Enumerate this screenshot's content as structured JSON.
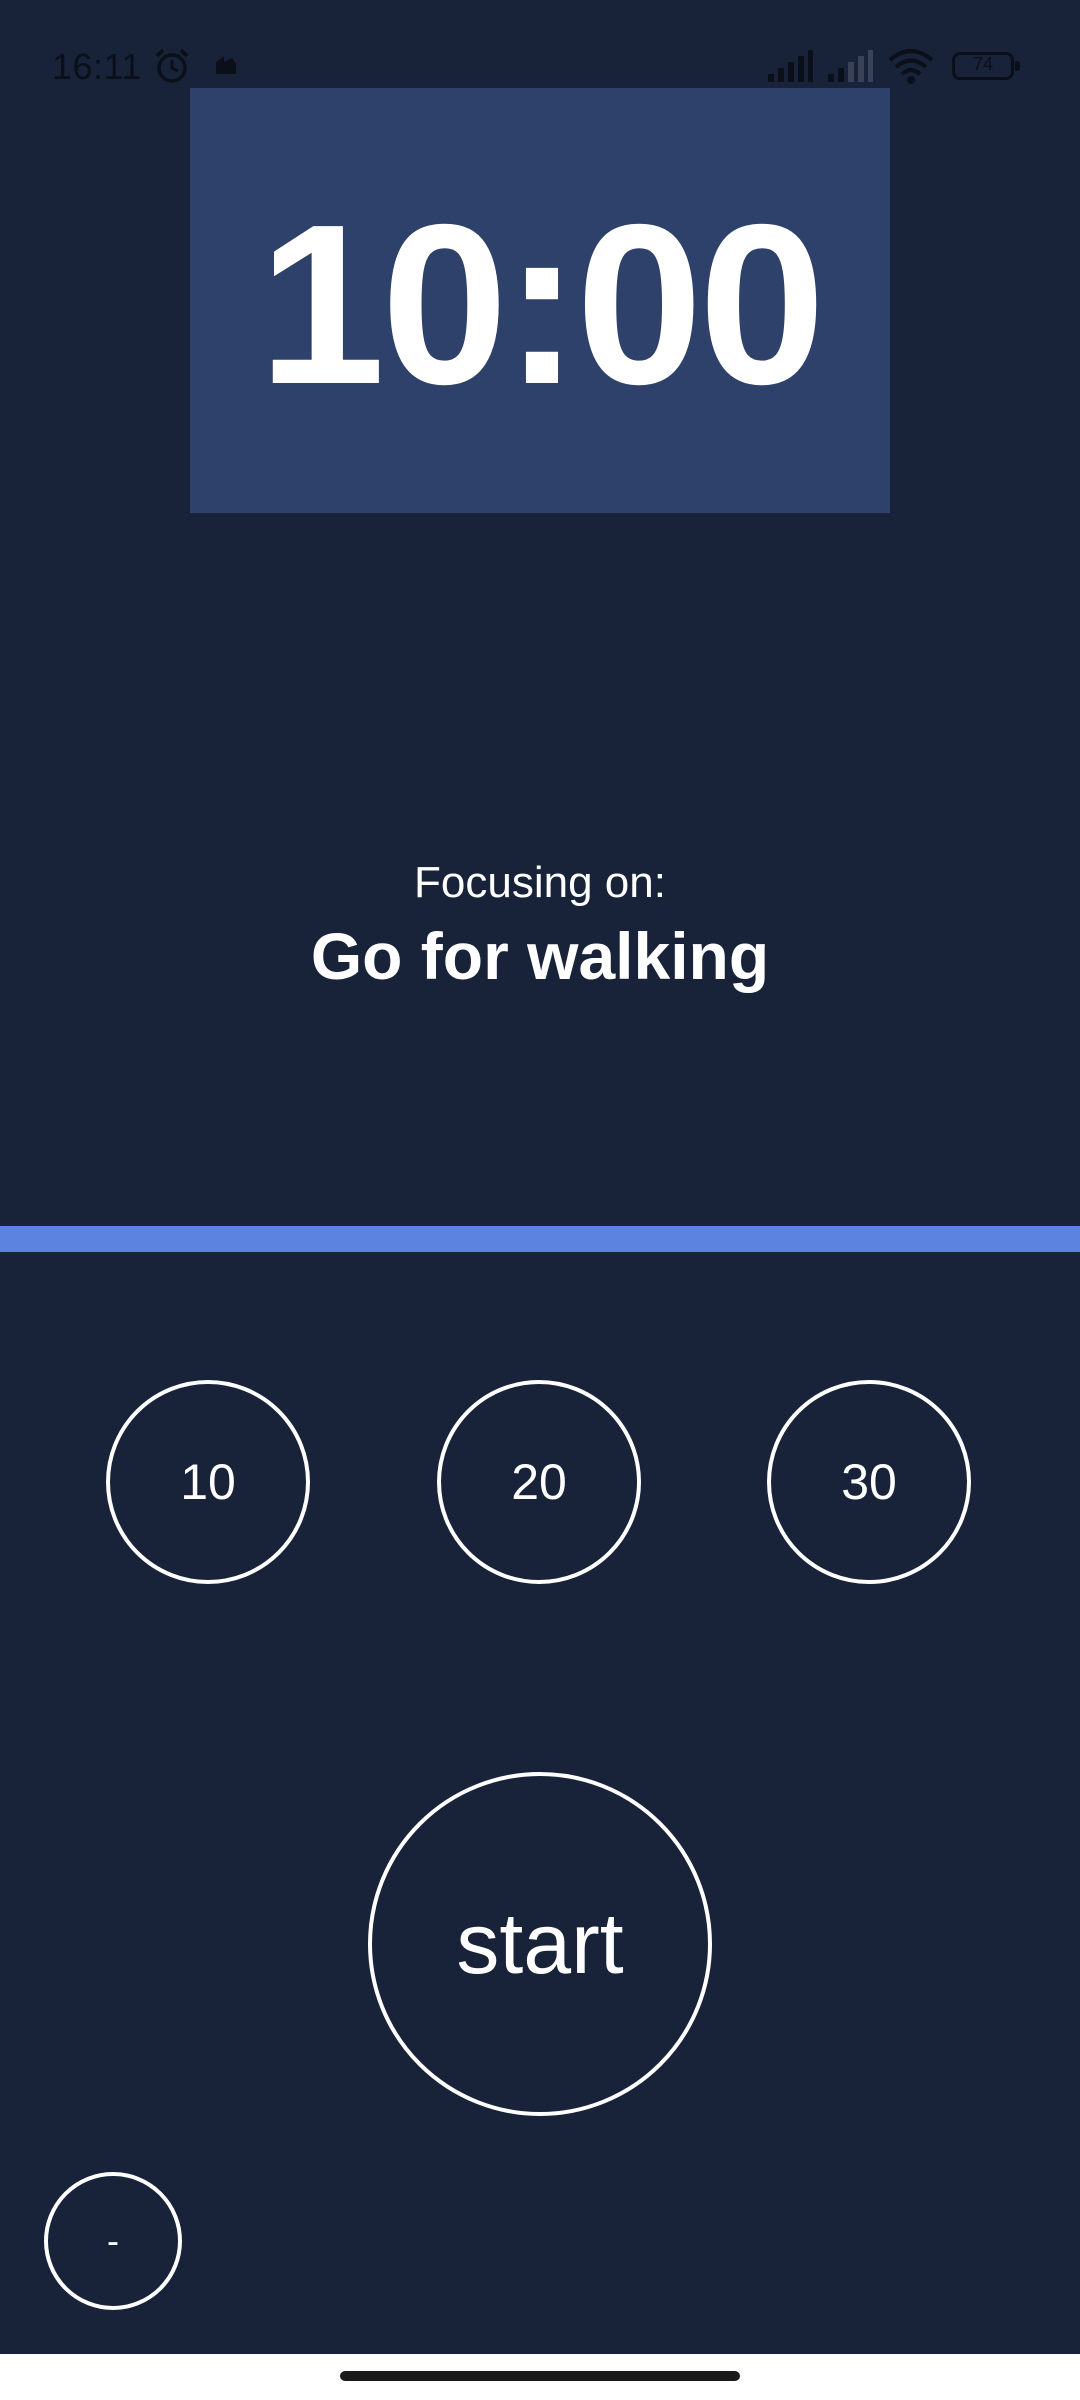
{
  "status_bar": {
    "time": "16:11",
    "battery_level": "74",
    "icons": [
      "alarm-icon",
      "notification-icon",
      "signal-icon",
      "signal-icon",
      "wifi-icon",
      "battery-icon"
    ]
  },
  "timer": {
    "value": "10:00"
  },
  "focus": {
    "label": "Focusing on:",
    "task": "Go for walking"
  },
  "progress": {
    "fraction": 1.0,
    "color": "#5c83e0"
  },
  "presets": [
    {
      "label": "10"
    },
    {
      "label": "20"
    },
    {
      "label": "30"
    }
  ],
  "start_label": "start",
  "minus_label": "-",
  "colors": {
    "background": "#182239",
    "timer_background": "#2e416b",
    "accent": "#5c83e0",
    "text": "#ffffff"
  }
}
